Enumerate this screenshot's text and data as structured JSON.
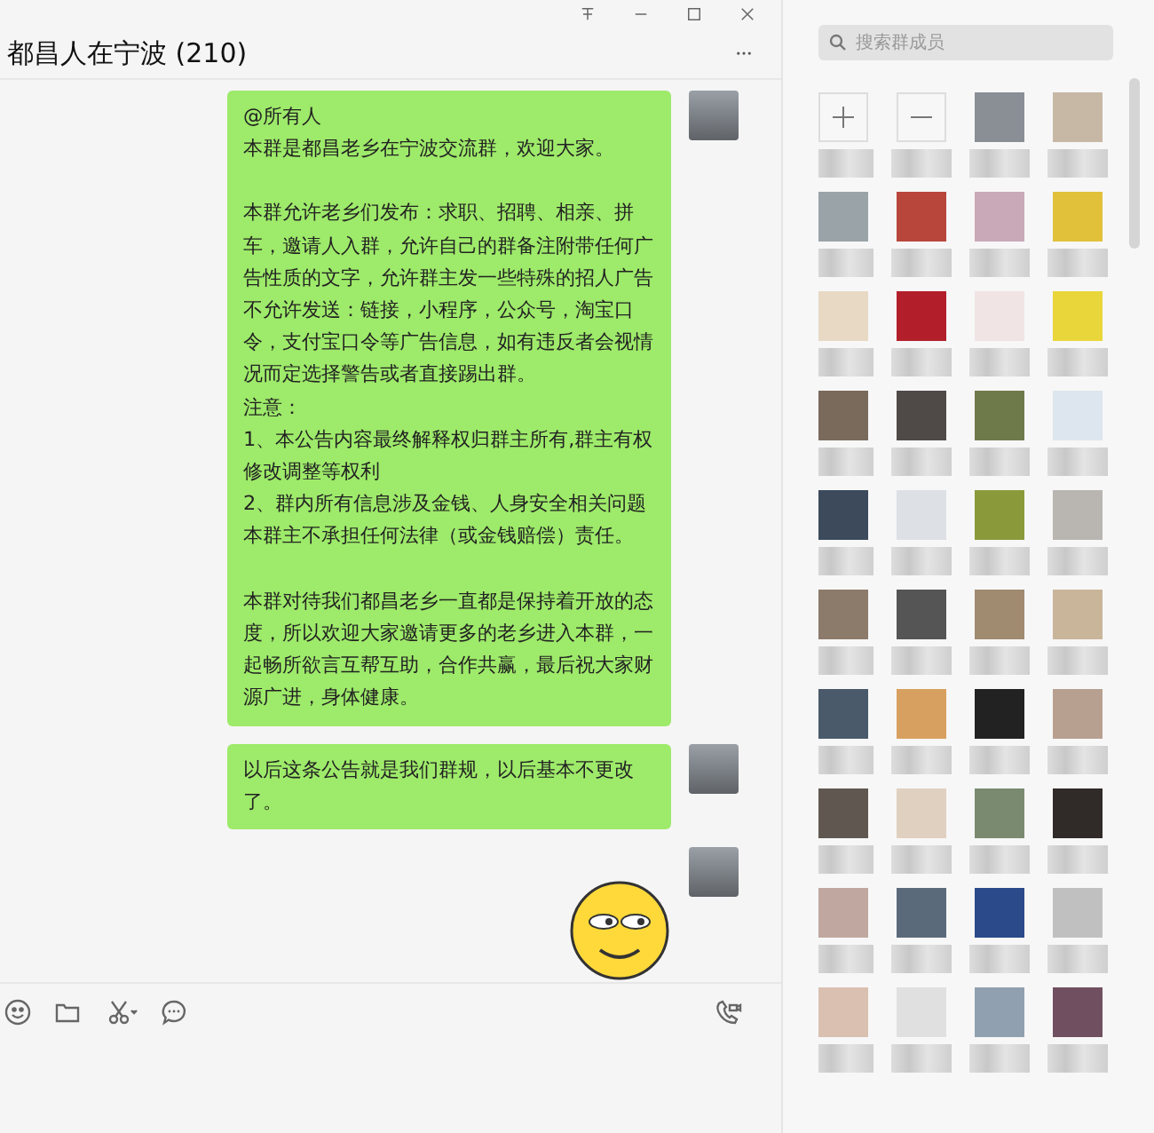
{
  "window": {
    "title": "都昌人在宁波 (210)"
  },
  "messages": [
    {
      "kind": "text",
      "paragraphs": [
        {
          "text": "@所有人",
          "space_before": false
        },
        {
          "text": "本群是都昌老乡在宁波交流群，欢迎大家。",
          "space_before": false
        },
        {
          "text": "本群允许老乡们发布：求职、招聘、相亲、拼车，邀请人入群，允许自己的群备注附带任何广告性质的文字，允许群主发一些特殊的招人广告",
          "space_before": true
        },
        {
          "text": "不允许发送：链接，小程序，公众号，淘宝口令，支付宝口令等广告信息，如有违反者会视情况而定选择警告或者直接踢出群。",
          "space_before": false
        },
        {
          "text": "注意：",
          "space_before": false
        },
        {
          "text": "1、本公告内容最终解释权归群主所有,群主有权修改调整等权利",
          "space_before": false
        },
        {
          "text": "2、群内所有信息涉及金钱、人身安全相关问题本群主不承担任何法律（或金钱赔偿）责任。",
          "space_before": false
        },
        {
          "text": "本群对待我们都昌老乡一直都是保持着开放的态度，所以欢迎大家邀请更多的老乡进入本群，一起畅所欲言互帮互助，合作共赢，最后祝大家财源广进，身体健康。",
          "space_before": true
        }
      ]
    },
    {
      "kind": "text",
      "paragraphs": [
        {
          "text": "以后这条公告就是我们群规，以后基本不更改了。",
          "space_before": false
        }
      ]
    },
    {
      "kind": "sticker"
    }
  ],
  "member_panel": {
    "search": {
      "placeholder": "搜索群成员"
    }
  }
}
